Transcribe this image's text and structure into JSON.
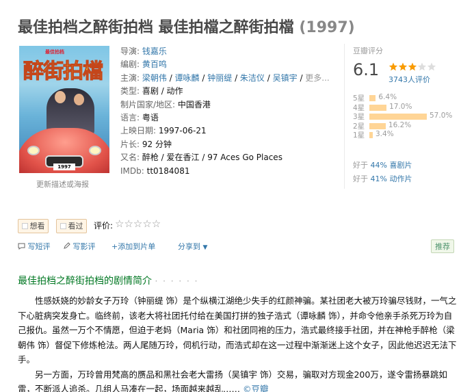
{
  "title": {
    "main": "最佳拍档之醉街拍档 最佳拍檔之醉街拍檔",
    "year": "(1997)"
  },
  "poster": {
    "logo_text": "醉街拍檔",
    "plate": "1997",
    "update_link": "更新描述或海报"
  },
  "info": {
    "director_label": "导演: ",
    "director": "钱嘉乐",
    "writer_label": "编剧: ",
    "writer": "黄百鸣",
    "cast_label": "主演: ",
    "cast": [
      "梁朝伟",
      "谭咏麟",
      "钟丽缇",
      "朱洁仪",
      "吴镇宇",
      "更多..."
    ],
    "genre_label": "类型: ",
    "genre": [
      "喜剧",
      "动作"
    ],
    "region_label": "制片国家/地区: ",
    "region": "中国香港",
    "language_label": "语言: ",
    "language": "粤语",
    "release_label": "上映日期: ",
    "release": "1997-06-21",
    "runtime_label": "片长: ",
    "runtime": "92 分钟",
    "aka_label": "又名: ",
    "aka": "醉枪 / 爱在香江 / 97 Aces Go Places",
    "imdb_label": "IMDb: ",
    "imdb": "tt0184081"
  },
  "rating": {
    "title": "豆瓣评分",
    "score": "6.1",
    "stars_filled": 3,
    "count": "3743人评价",
    "breakdown": [
      {
        "label": "5星",
        "percent": 6.4,
        "text": "6.4%"
      },
      {
        "label": "4星",
        "percent": 17.0,
        "text": "17.0%"
      },
      {
        "label": "3星",
        "percent": 57.0,
        "text": "57.0%"
      },
      {
        "label": "2星",
        "percent": 16.2,
        "text": "16.2%"
      },
      {
        "label": "1星",
        "percent": 3.4,
        "text": "3.4%"
      }
    ],
    "better1_prefix": "好于 ",
    "better1_link": "44% 喜剧片",
    "better2_prefix": "好于 ",
    "better2_link": "41% 动作片"
  },
  "actions": {
    "want": "想看",
    "seen": "看过",
    "rate_label": "评价:",
    "rate_stars": "☆☆☆☆☆"
  },
  "tools": {
    "short_review": "写短评",
    "review": "写影评",
    "add_list": "+添加到片单",
    "share": "分享到",
    "recommend": "推荐"
  },
  "synopsis": {
    "heading": "最佳拍档之醉街拍档的剧情简介",
    "dots": "· · · · · ·",
    "p1": "性感妖娆的妙龄女子万玲（钟丽缇 饰）是个纵横江湖绝少失手的红颜神骗。某社团老大被万玲骗尽钱财，一气之下心脏病突发身亡。临终前，该老大将社团托付给在美国打拼的独子浩式（谭咏麟 饰），并命令他亲手杀死万玲为自己报仇。虽然一万个不情愿，但迫于老妈（Maria 饰）和社团同袍的压力，浩式最终接手社团，并在神枪手醉枪（梁朝伟 饰）督促下修炼枪法。两人尾随万玲，伺机行动，而浩式却在这一过程中渐渐迷上这个女子，因此他迟迟无法下手。",
    "p2": "另一方面，万玲曾用梵高的赝品和黑社会老大雷扬（吴镇宇 饰）交易，骗取对方现金200万，遂令雷扬暴跳如雷，不断派人追杀。几组人马凑在一起，场面越来越乱……",
    "source": "©豆瓣"
  }
}
